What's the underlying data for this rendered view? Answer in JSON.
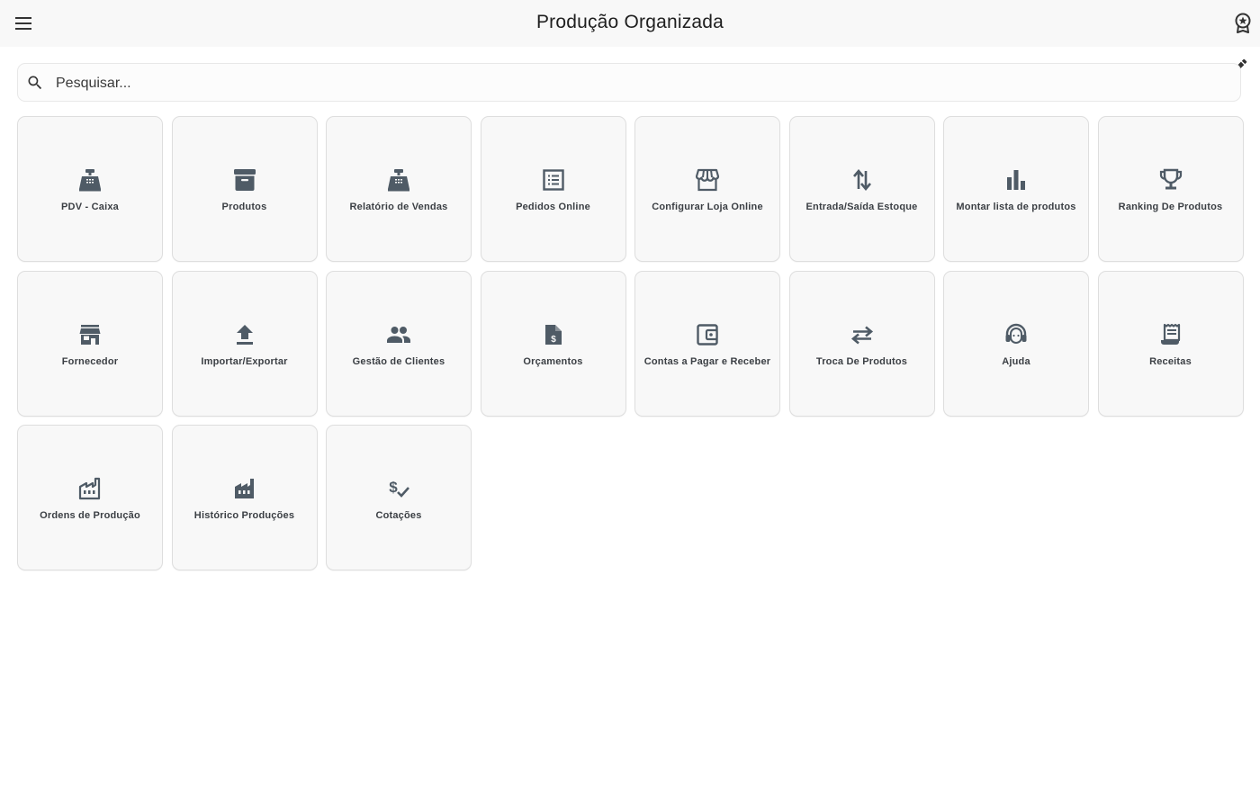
{
  "appbar": {
    "title": "Produção Organizada",
    "menu_icon": "menu-icon",
    "right_icon": "award-icon"
  },
  "edit_icon": "pencil-icon",
  "search": {
    "placeholder": "Pesquisar...",
    "value": "",
    "icon": "search-icon"
  },
  "colors": {
    "icon": "#4f5b66",
    "tile_bg": "#f8f8f8",
    "tile_border": "#dedede",
    "appbar_bg": "#f8f8f8"
  },
  "tiles": [
    {
      "label": "PDV - Caixa",
      "icon": "cash-register-icon"
    },
    {
      "label": "Produtos",
      "icon": "archive-box-icon"
    },
    {
      "label": "Relatório de Vendas",
      "icon": "cash-register-icon"
    },
    {
      "label": "Pedidos Online",
      "icon": "list-document-icon"
    },
    {
      "label": "Configurar Loja Online",
      "icon": "storefront-icon"
    },
    {
      "label": "Entrada/Saída Estoque",
      "icon": "up-down-arrows-icon"
    },
    {
      "label": "Montar lista de produtos",
      "icon": "bar-chart-icon"
    },
    {
      "label": "Ranking De Produtos",
      "icon": "trophy-icon"
    },
    {
      "label": "Fornecedor",
      "icon": "store-icon"
    },
    {
      "label": "Importar/Exportar",
      "icon": "upload-icon"
    },
    {
      "label": "Gestão de Clientes",
      "icon": "people-icon"
    },
    {
      "label": "Orçamentos",
      "icon": "dollar-document-icon"
    },
    {
      "label": "Contas a Pagar e Receber",
      "icon": "wallet-icon"
    },
    {
      "label": "Troca De Produtos",
      "icon": "swap-arrows-icon"
    },
    {
      "label": "Ajuda",
      "icon": "headset-icon"
    },
    {
      "label": "Receitas",
      "icon": "receipt-icon"
    },
    {
      "label": "Ordens de Produção",
      "icon": "factory-outline-icon"
    },
    {
      "label": "Histórico Produções",
      "icon": "factory-icon"
    },
    {
      "label": "Cotações",
      "icon": "price-check-icon"
    }
  ]
}
